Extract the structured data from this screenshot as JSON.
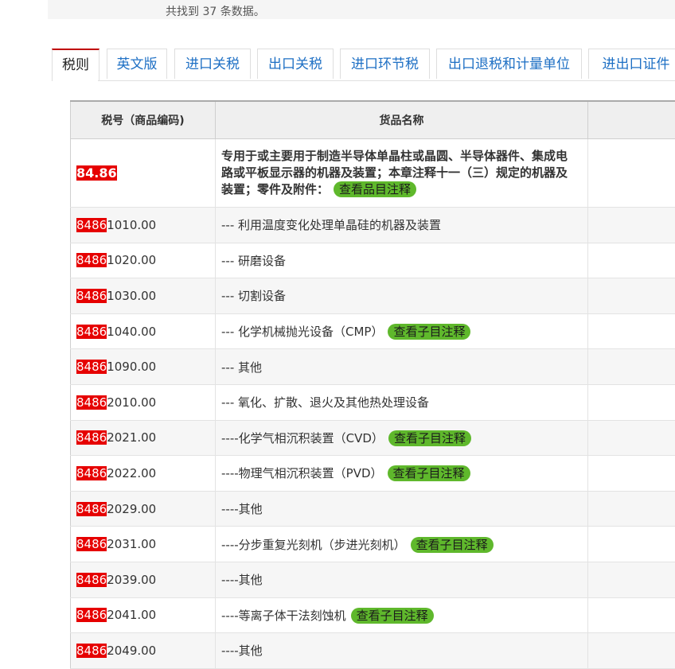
{
  "result_count_text": "共找到 37 条数据。",
  "tabs": [
    {
      "label": "税则",
      "active": true
    },
    {
      "label": "英文版"
    },
    {
      "label": "进口关税"
    },
    {
      "label": "出口关税"
    },
    {
      "label": "进口环节税"
    },
    {
      "label": "出口退税和计量单位"
    },
    {
      "label": "进出口证件"
    }
  ],
  "table": {
    "headers": [
      "税号（商品编码)",
      "货品名称",
      ""
    ],
    "heading_row": {
      "code": "84.86",
      "name": "专用于或主要用于制造半导体单晶柱或晶圆、半导体器件、集成电路或平板显示器的机器及装置；本章注释十一（三）规定的机器及装置；零件及附件：",
      "badge": "查看品目注释"
    },
    "rows": [
      {
        "prefix": "8486",
        "suffix": "1010.00",
        "name": "--- 利用温度变化处理单晶硅的机器及装置",
        "badge": ""
      },
      {
        "prefix": "8486",
        "suffix": "1020.00",
        "name": "--- 研磨设备",
        "badge": ""
      },
      {
        "prefix": "8486",
        "suffix": "1030.00",
        "name": "--- 切割设备",
        "badge": ""
      },
      {
        "prefix": "8486",
        "suffix": "1040.00",
        "name": "--- 化学机械抛光设备（CMP）",
        "badge": "查看子目注释"
      },
      {
        "prefix": "8486",
        "suffix": "1090.00",
        "name": "--- 其他",
        "badge": ""
      },
      {
        "prefix": "8486",
        "suffix": "2010.00",
        "name": "--- 氧化、扩散、退火及其他热处理设备",
        "badge": ""
      },
      {
        "prefix": "8486",
        "suffix": "2021.00",
        "name": "----化学气相沉积装置（CVD）",
        "badge": "查看子目注释"
      },
      {
        "prefix": "8486",
        "suffix": "2022.00",
        "name": "----物理气相沉积装置（PVD）",
        "badge": "查看子目注释"
      },
      {
        "prefix": "8486",
        "suffix": "2029.00",
        "name": "----其他",
        "badge": ""
      },
      {
        "prefix": "8486",
        "suffix": "2031.00",
        "name": "----分步重复光刻机（步进光刻机）",
        "badge": "查看子目注释"
      },
      {
        "prefix": "8486",
        "suffix": "2039.00",
        "name": "----其他",
        "badge": ""
      },
      {
        "prefix": "8486",
        "suffix": "2041.00",
        "name": "----等离子体干法刻蚀机",
        "badge": "查看子目注释"
      },
      {
        "prefix": "8486",
        "suffix": "2049.00",
        "name": "----其他",
        "badge": ""
      }
    ]
  }
}
